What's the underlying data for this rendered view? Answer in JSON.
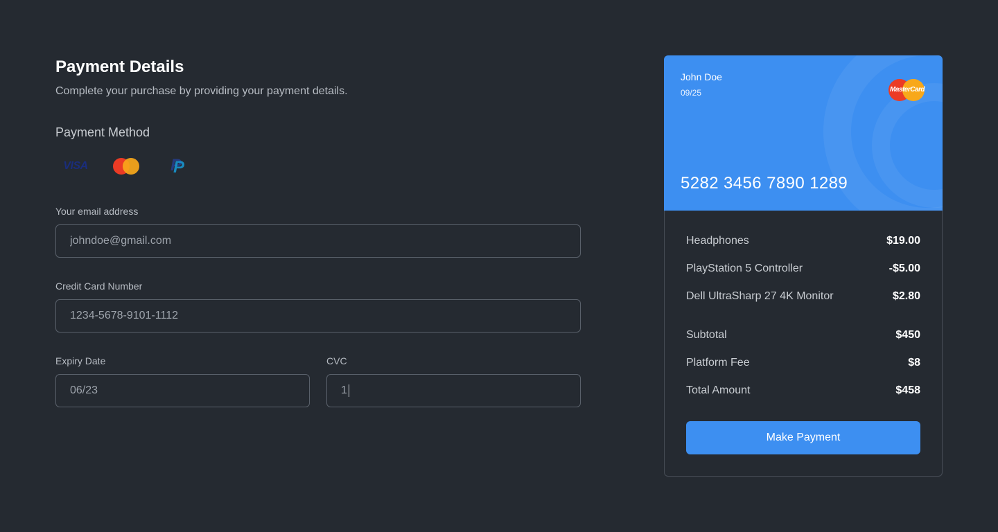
{
  "header": {
    "title": "Payment Details",
    "subtitle": "Complete your purchase by providing your payment details."
  },
  "payment_method": {
    "label": "Payment Method",
    "methods": [
      {
        "name": "visa",
        "text": "VISA"
      },
      {
        "name": "mastercard",
        "icon": "mastercard-icon"
      },
      {
        "name": "paypal",
        "icon": "paypal-icon",
        "text": "P"
      }
    ]
  },
  "fields": {
    "email": {
      "label": "Your email address",
      "placeholder": "johndoe@gmail.com"
    },
    "card_number": {
      "label": "Credit Card Number",
      "placeholder": "1234-5678-9101-1112"
    },
    "expiry": {
      "label": "Expiry Date",
      "placeholder": "06/23"
    },
    "cvc": {
      "label": "CVC",
      "value": "1"
    }
  },
  "card": {
    "holder": "John Doe",
    "expiry": "09/25",
    "brand_text": "MasterCard",
    "number": "5282 3456 7890 1289",
    "color": "#3d8ff1"
  },
  "summary": {
    "items": [
      {
        "label": "Headphones",
        "amount": "$19.00"
      },
      {
        "label": "PlayStation 5 Controller",
        "amount": "-$5.00"
      },
      {
        "label": "Dell UltraSharp 27 4K Monitor",
        "amount": "$2.80"
      }
    ],
    "totals": [
      {
        "label": "Subtotal",
        "amount": "$450"
      },
      {
        "label": "Platform Fee",
        "amount": "$8"
      },
      {
        "label": "Total Amount",
        "amount": "$458"
      }
    ],
    "button_label": "Make Payment"
  },
  "colors": {
    "background": "#252a31",
    "accent": "#3d8ff1"
  }
}
